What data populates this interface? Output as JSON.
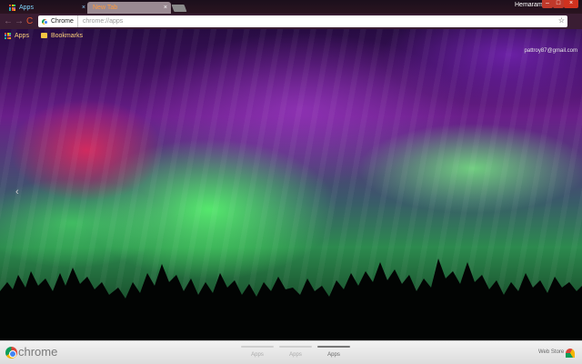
{
  "tabs": [
    {
      "label": "Apps",
      "close": "×"
    },
    {
      "label": "New Tab",
      "close": "×"
    }
  ],
  "window": {
    "profile_name": "Hemaram",
    "minimize": "–",
    "maximize": "□",
    "close": "×"
  },
  "toolbar": {
    "back": "←",
    "forward": "→",
    "reload": "C",
    "omnibox_chip": "Chrome",
    "url": "chrome://apps",
    "star": "☆"
  },
  "bookmarks_bar": {
    "apps_label": "Apps",
    "bookmarks_label": "Bookmarks"
  },
  "account_email": "pattroy87@gmail.com",
  "nav_arrow": "‹",
  "bottom_bar": {
    "logo_text": "chrome",
    "page_switchers": [
      "Apps",
      "Apps",
      "Apps"
    ],
    "active_page_index": 2,
    "web_store_label": "Web Store"
  },
  "colors": {
    "tab_active_text": "#ff9a3c",
    "tab_inactive_text": "#7fd8ff",
    "window_button": "#c0392b",
    "bookmark_text": "#ffd27a"
  }
}
